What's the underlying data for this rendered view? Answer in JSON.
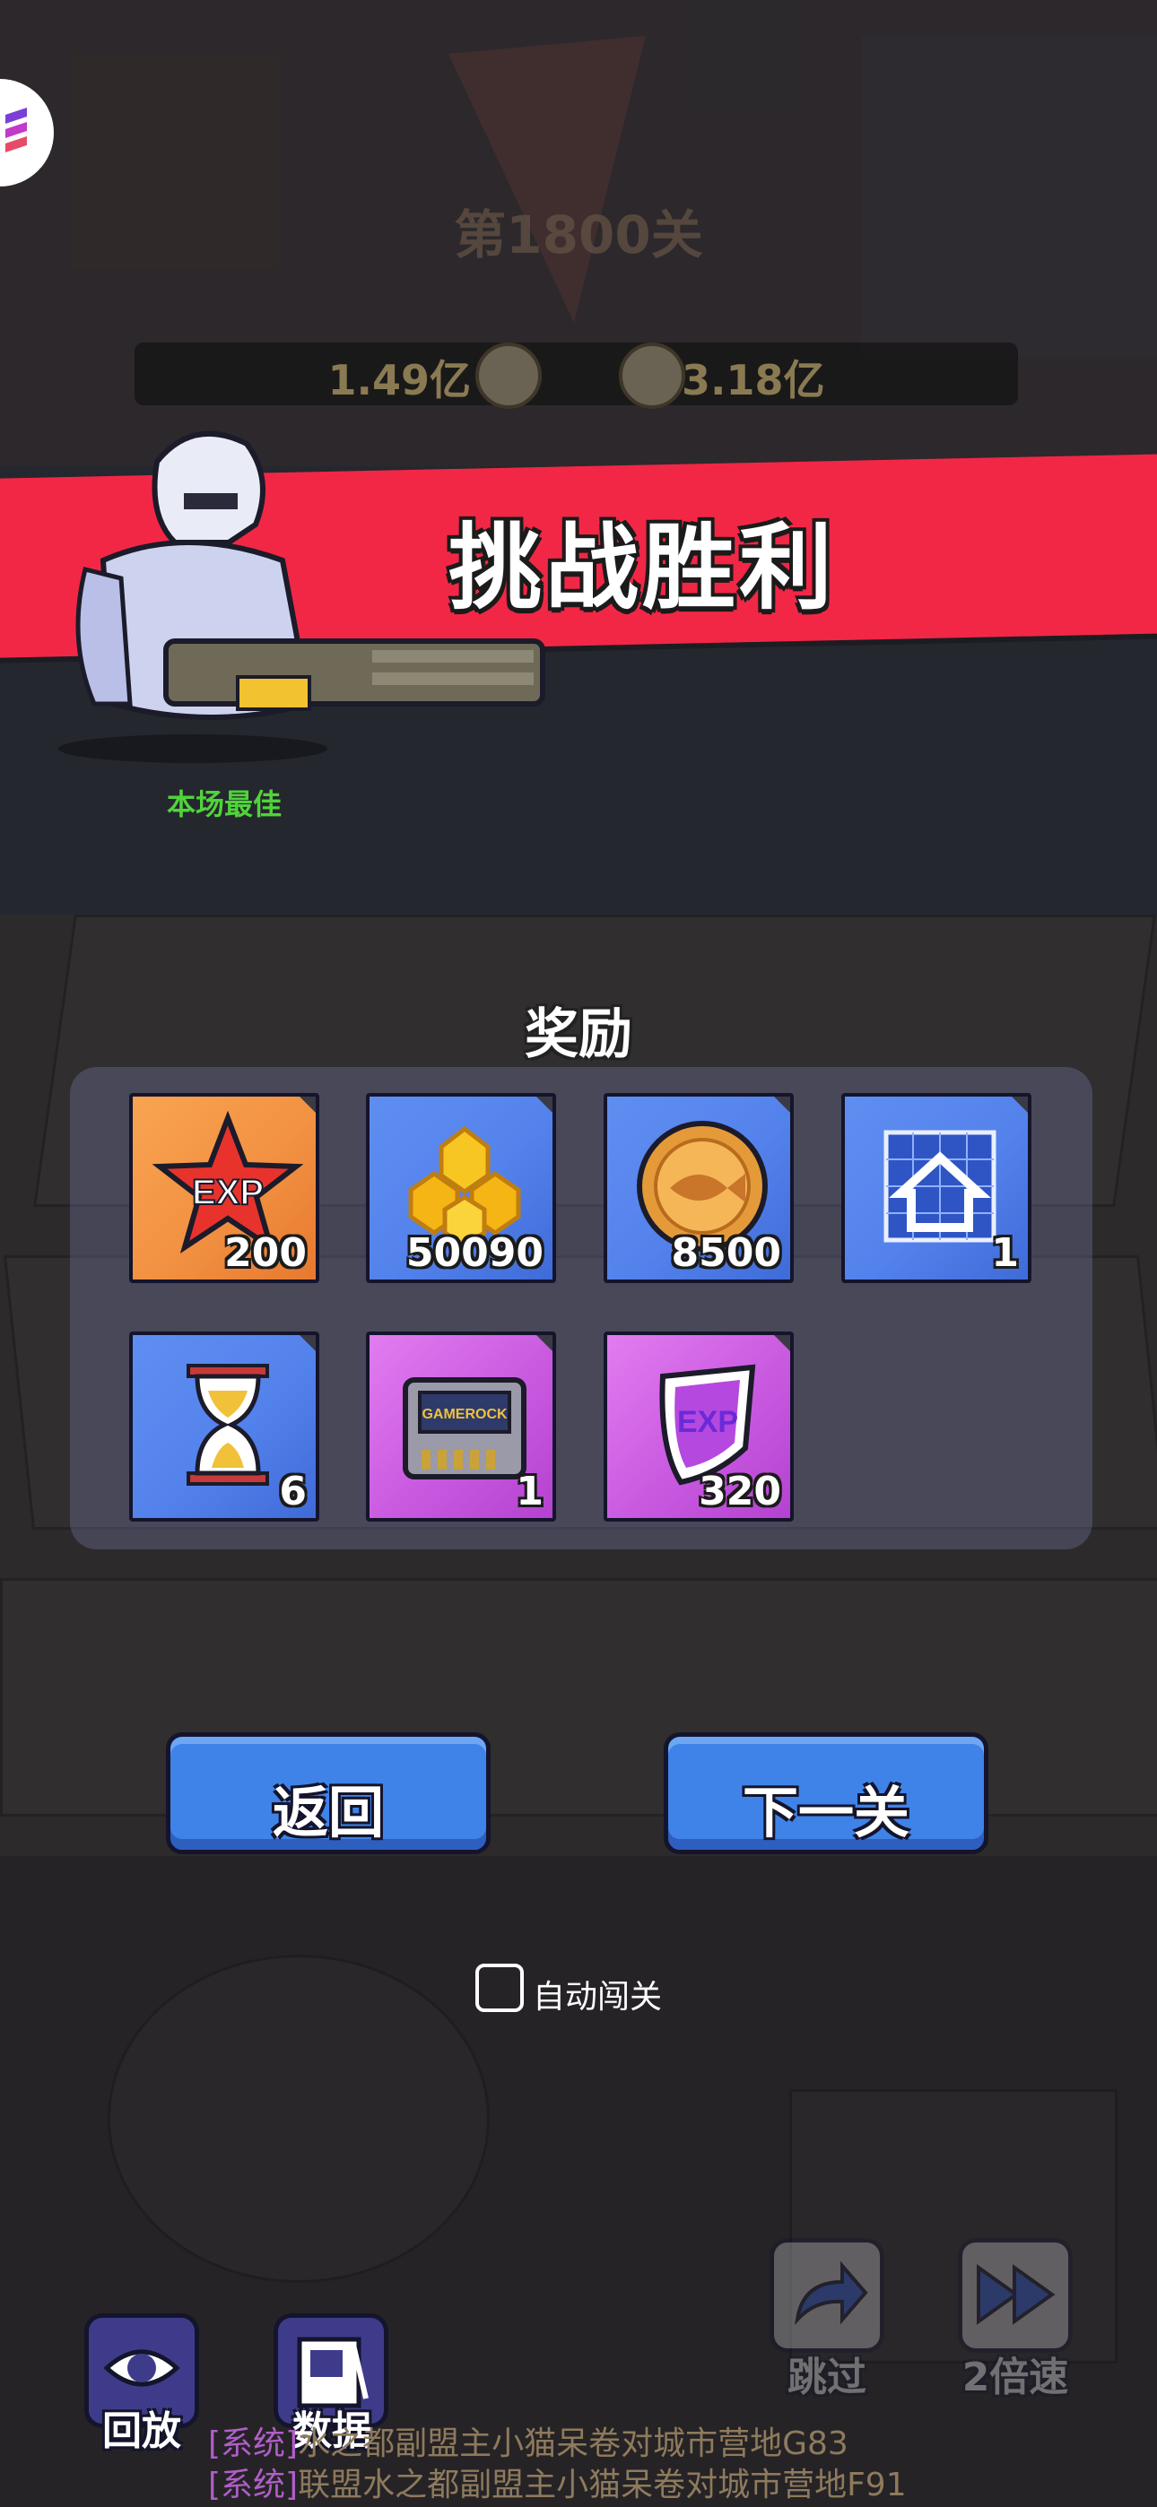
{
  "stage": {
    "title": "第1800关",
    "power_left": "1.49亿",
    "power_right": "3.18亿"
  },
  "result": {
    "banner_title": "挑战胜利",
    "mvp_label": "本场最佳"
  },
  "rewards": {
    "title": "奖励",
    "items": [
      {
        "icon": "exp-star-icon",
        "count": "200",
        "color": "#f29142"
      },
      {
        "icon": "gold-gem-cluster-icon",
        "count": "50090",
        "color": "#5482ec"
      },
      {
        "icon": "fish-coin-icon",
        "count": "8500",
        "color": "#5482ec"
      },
      {
        "icon": "house-blueprint-icon",
        "count": "1",
        "color": "#5482ec"
      },
      {
        "icon": "hourglass-icon",
        "count": "6",
        "color": "#5482ec"
      },
      {
        "icon": "game-cartridge-icon",
        "count": "1",
        "color": "#c95ae0"
      },
      {
        "icon": "exp-shield-icon",
        "count": "320",
        "color": "#c95ae0"
      }
    ]
  },
  "buttons": {
    "back": "返回",
    "next": "下一关"
  },
  "auto": {
    "label": "自动闯关",
    "checked": false
  },
  "controls": {
    "replay": "回放",
    "data": "数据",
    "skip": "跳过",
    "speed": "2倍速"
  },
  "chat": [
    {
      "tag": "[系统]",
      "text": "水之都副盟主小猫呆卷对城市营地G83"
    },
    {
      "tag": "[系统]",
      "text": "联盟水之都副盟主小猫呆卷对城市营地F91"
    }
  ],
  "colors": {
    "banner": "#f22746",
    "button": "#3f83e9",
    "mvp_label": "#50d33b"
  }
}
